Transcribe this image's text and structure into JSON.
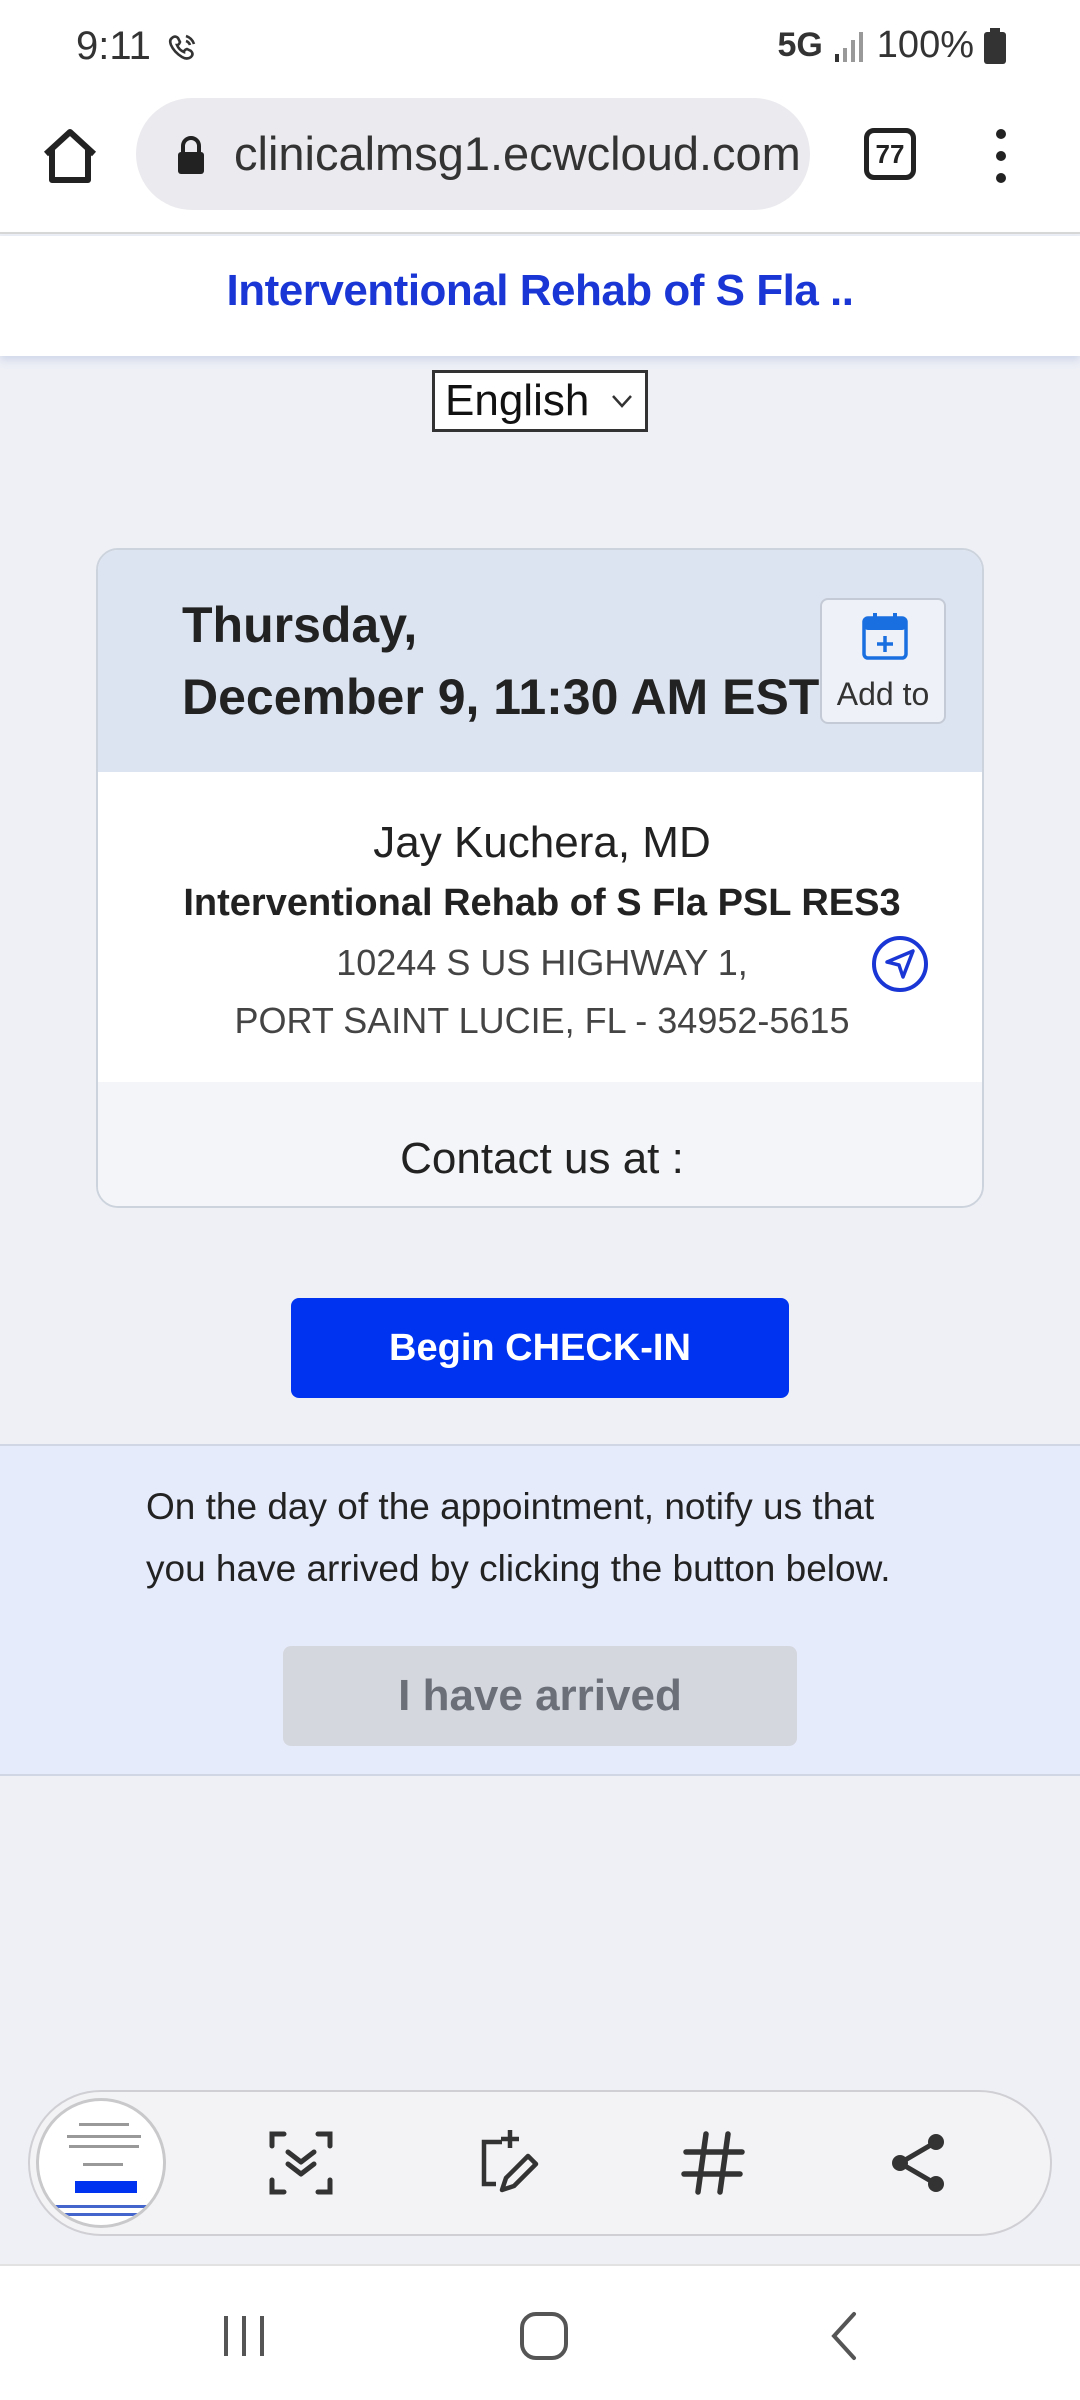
{
  "status_bar": {
    "time": "9:11",
    "network": "5G",
    "battery": "100%"
  },
  "browser": {
    "url": "clinicalmsg1.ecwcloud.com",
    "tab_count": "77"
  },
  "site": {
    "title": "Interventional Rehab of S Fla .."
  },
  "language": {
    "selected": "English"
  },
  "appointment": {
    "day": "Thursday,",
    "datetime": "December 9, 11:30 AM EST",
    "add_to_label": "Add to",
    "doctor": "Jay Kuchera, MD",
    "practice": "Interventional Rehab of S Fla PSL RES3",
    "address_line1": "10244 S US HIGHWAY 1,",
    "address_line2": "PORT SAINT LUCIE, FL - 34952-5615",
    "contact_label": "Contact us at :"
  },
  "checkin": {
    "button_label": "Begin CHECK-IN"
  },
  "arrived": {
    "instructions": "On the day of the appointment, notify us that you have arrived by clicking the button below.",
    "button_label": "I have arrived"
  },
  "toolbar": {
    "icons": [
      "screenshot-thumbnail",
      "scroll-capture-icon",
      "draw-icon",
      "hashtag-icon",
      "share-icon"
    ]
  },
  "colors": {
    "accent_blue": "#0033f0",
    "title_blue": "#1a37d6",
    "card_header": "#dce4f2",
    "arrived_bg": "#e6ebfb"
  }
}
